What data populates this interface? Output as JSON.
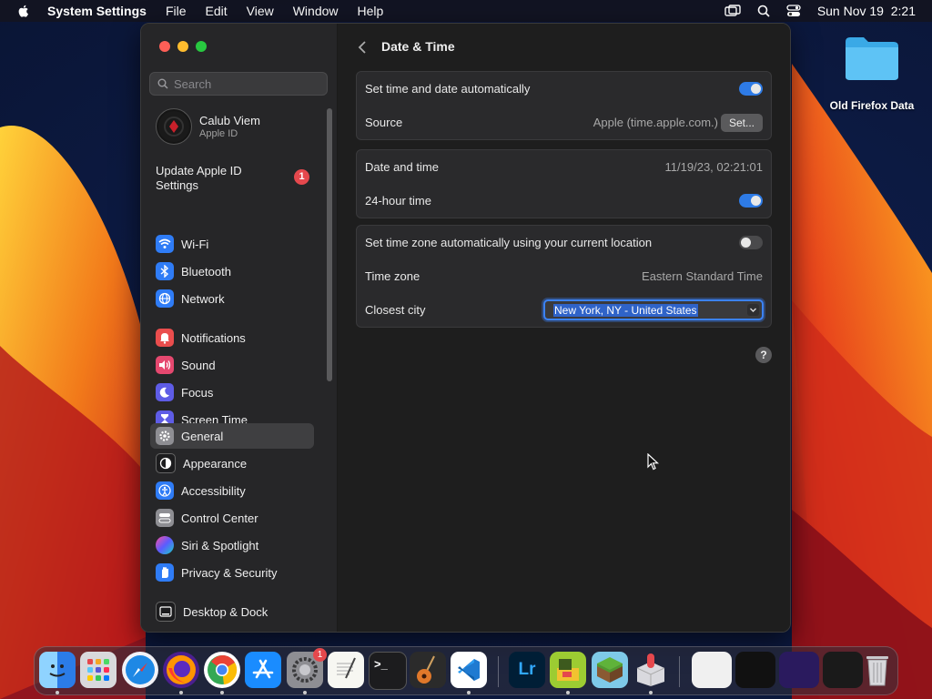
{
  "menubar": {
    "app_name": "System Settings",
    "menus": [
      "File",
      "Edit",
      "View",
      "Window",
      "Help"
    ],
    "clock": "Sun Nov 19  2:21"
  },
  "desktop": {
    "folder_label": "Old Firefox Data"
  },
  "sidebar": {
    "search_placeholder": "Search",
    "account": {
      "name": "Calub Viem",
      "subtitle": "Apple ID"
    },
    "update": {
      "label": "Update Apple ID Settings",
      "badge": "1"
    },
    "items": [
      {
        "label": "Wi-Fi",
        "icon": "wifi-icon",
        "color": "#2f7cf6"
      },
      {
        "label": "Bluetooth",
        "icon": "bluetooth-icon",
        "color": "#2f7cf6"
      },
      {
        "label": "Network",
        "icon": "globe-icon",
        "color": "#2f7cf6"
      },
      {
        "label": "Notifications",
        "icon": "bell-icon",
        "color": "#ea4d4d"
      },
      {
        "label": "Sound",
        "icon": "speaker-icon",
        "color": "#e5486f"
      },
      {
        "label": "Focus",
        "icon": "moon-icon",
        "color": "#5e5ce6"
      },
      {
        "label": "Screen Time",
        "icon": "hourglass-icon",
        "color": "#5e5ce6"
      },
      {
        "label": "General",
        "icon": "gear-icon",
        "color": "#8e8e93"
      },
      {
        "label": "Appearance",
        "icon": "appearance-icon",
        "color": "#1c1c1e"
      },
      {
        "label": "Accessibility",
        "icon": "accessibility-icon",
        "color": "#2f7cf6"
      },
      {
        "label": "Control Center",
        "icon": "control-center-icon",
        "color": "#8e8e93"
      },
      {
        "label": "Siri & Spotlight",
        "icon": "siri-icon",
        "color": "#a04fd8"
      },
      {
        "label": "Privacy & Security",
        "icon": "hand-icon",
        "color": "#2f7cf6"
      },
      {
        "label": "Desktop & Dock",
        "icon": "dock-icon",
        "color": "#1c1c1e"
      }
    ],
    "active": "General"
  },
  "main": {
    "title": "Date & Time",
    "groups": [
      {
        "rows": [
          {
            "label": "Set time and date automatically",
            "toggle": true
          },
          {
            "label": "Source",
            "value": "Apple (time.apple.com.)",
            "button": "Set..."
          }
        ]
      },
      {
        "rows": [
          {
            "label": "Date and time",
            "value": "11/19/23, 02:21:01"
          },
          {
            "label": "24-hour time",
            "toggle": true
          }
        ]
      },
      {
        "rows": [
          {
            "label": "Set time zone automatically using your current location",
            "toggle": false
          },
          {
            "label": "Time zone",
            "value": "Eastern Standard Time"
          },
          {
            "label": "Closest city",
            "select": "New York, NY - United States"
          }
        ]
      }
    ],
    "help": "?"
  },
  "dock": {
    "apps": [
      "finder",
      "launchpad",
      "safari",
      "firefox",
      "chrome",
      "app-store",
      "system-settings",
      "textedit",
      "terminal",
      "garageband",
      "vscode",
      "lightroom",
      "minecraft-dungeons",
      "minecraft",
      "parallels-toolbox"
    ],
    "system_settings_badge": "1",
    "lightroom_label": "Lr"
  }
}
